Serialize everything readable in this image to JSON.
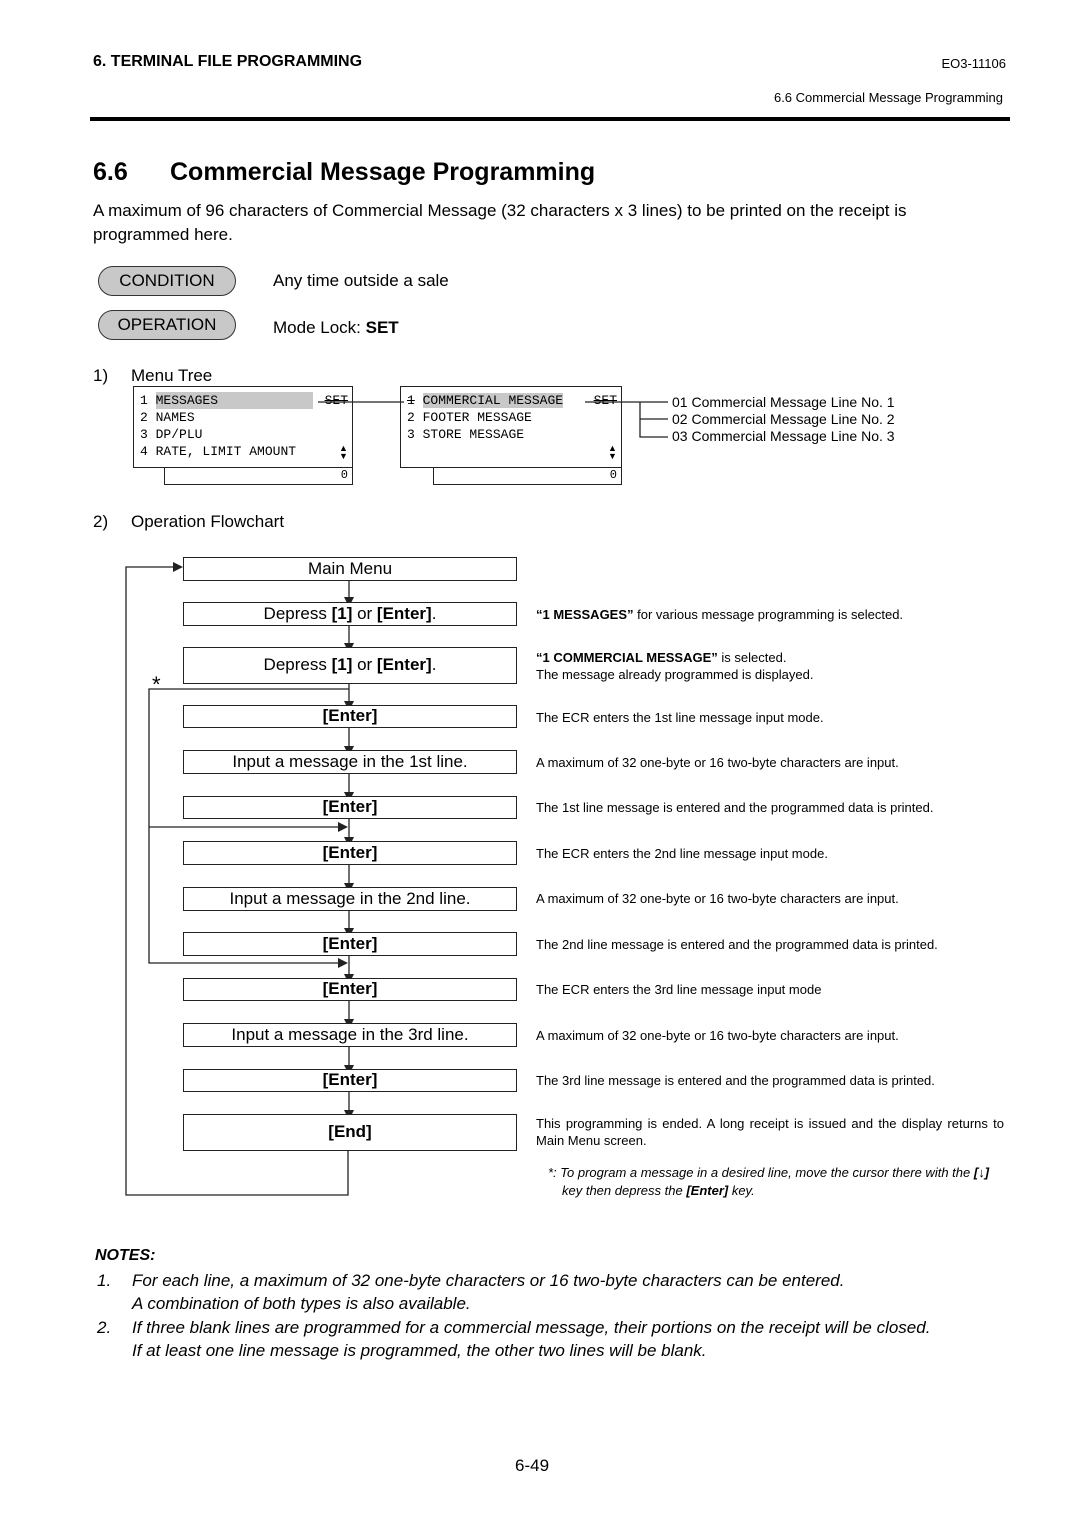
{
  "header": {
    "chapter": "6. TERMINAL FILE PROGRAMMING",
    "doc_number": "EO3-11106",
    "section_ref": "6.6 Commercial Message Programming"
  },
  "title": {
    "number": "6.6",
    "text": "Commercial Message Programming"
  },
  "intro": "A maximum of 96 characters of Commercial Message (32 characters x 3 lines) to be printed on the receipt is programmed here.",
  "condition": {
    "label": "CONDITION",
    "text": "Any time outside a sale"
  },
  "operation": {
    "label": "OPERATION",
    "text_prefix": "Mode Lock: ",
    "text_bold": "SET"
  },
  "menu_tree": {
    "step_num": "1)",
    "step_label": "Menu Tree",
    "screen1": {
      "rows": [
        {
          "num": "1",
          "label": "MESSAGES",
          "highlighted": true,
          "suffix": "SET"
        },
        {
          "num": "2",
          "label": "NAMES"
        },
        {
          "num": "3",
          "label": "DP/PLU"
        },
        {
          "num": "4",
          "label": "RATE, LIMIT AMOUNT"
        }
      ],
      "scroll_icon": "up-down-arrow-icon",
      "footer_value": "0"
    },
    "screen2": {
      "rows": [
        {
          "num": "1",
          "label": "COMMERCIAL MESSAGE",
          "highlighted": true,
          "suffix": "SET"
        },
        {
          "num": "2",
          "label": "FOOTER MESSAGE"
        },
        {
          "num": "3",
          "label": "STORE MESSAGE"
        }
      ],
      "scroll_icon": "up-down-arrow-icon",
      "footer_value": "0"
    },
    "subitems": [
      "01 Commercial Message Line No. 1",
      "02 Commercial Message Line No. 2",
      "03 Commercial Message Line No. 3"
    ]
  },
  "flowchart": {
    "step_num": "2)",
    "step_label": "Operation Flowchart",
    "asterisk": "*",
    "steps": [
      {
        "text": "Main Menu",
        "desc": ""
      },
      {
        "pre": "Depress ",
        "k1": "[1]",
        "mid": " or ",
        "k2": "[Enter]",
        "post": ".",
        "desc_bold": "“1 MESSAGES”",
        "desc": " for various message programming is selected."
      },
      {
        "pre": "Depress ",
        "k1": "[1]",
        "mid": " or ",
        "k2": "[Enter]",
        "post": ".",
        "desc_bold": "“1 COMMERCIAL MESSAGE”",
        "desc": " is selected.",
        "desc2": "The message already programmed is displayed."
      },
      {
        "key": "[Enter]",
        "desc": "The ECR enters the 1st line message input mode."
      },
      {
        "text": "Input a message in the 1st line.",
        "desc": "A maximum of 32 one-byte or 16 two-byte characters are input."
      },
      {
        "key": "[Enter]",
        "desc": "The 1st line message is entered and the programmed data is printed."
      },
      {
        "key": "[Enter]",
        "desc": "The ECR enters the 2nd line message input mode."
      },
      {
        "text": "Input a message in the 2nd line.",
        "desc": "A maximum of 32 one-byte or 16 two-byte characters are input."
      },
      {
        "key": "[Enter]",
        "desc": "The 2nd line message is entered and the programmed data is printed."
      },
      {
        "key": "[Enter]",
        "desc": "The ECR enters the 3rd line message input mode"
      },
      {
        "text": "Input a message in the 3rd line.",
        "desc": "A maximum of 32 one-byte or 16 two-byte characters are input."
      },
      {
        "key": "[Enter]",
        "desc": "The 3rd line message is entered and the programmed data is printed."
      },
      {
        "key": "[End]",
        "desc": "This programming is ended.  A long receipt is issued and the display returns to Main Menu screen."
      }
    ],
    "footnote": {
      "pre": "*: To program a message in a desired line, move the cursor there with the ",
      "key1": "[↓]",
      "mid": " key then depress the ",
      "key2": "[Enter]",
      "post": " key."
    }
  },
  "notes": {
    "title": "NOTES:",
    "items": [
      {
        "num": "1.",
        "line1": "For each line, a maximum of 32 one-byte characters or 16 two-byte characters can be entered.",
        "line2": "A combination of both types is also available."
      },
      {
        "num": "2.",
        "line1": "If three blank lines are programmed for a commercial message, their portions on the receipt will be closed.",
        "line2": "If at least one line message is programmed, the other two lines will be blank."
      }
    ]
  },
  "page_number": "6-49"
}
